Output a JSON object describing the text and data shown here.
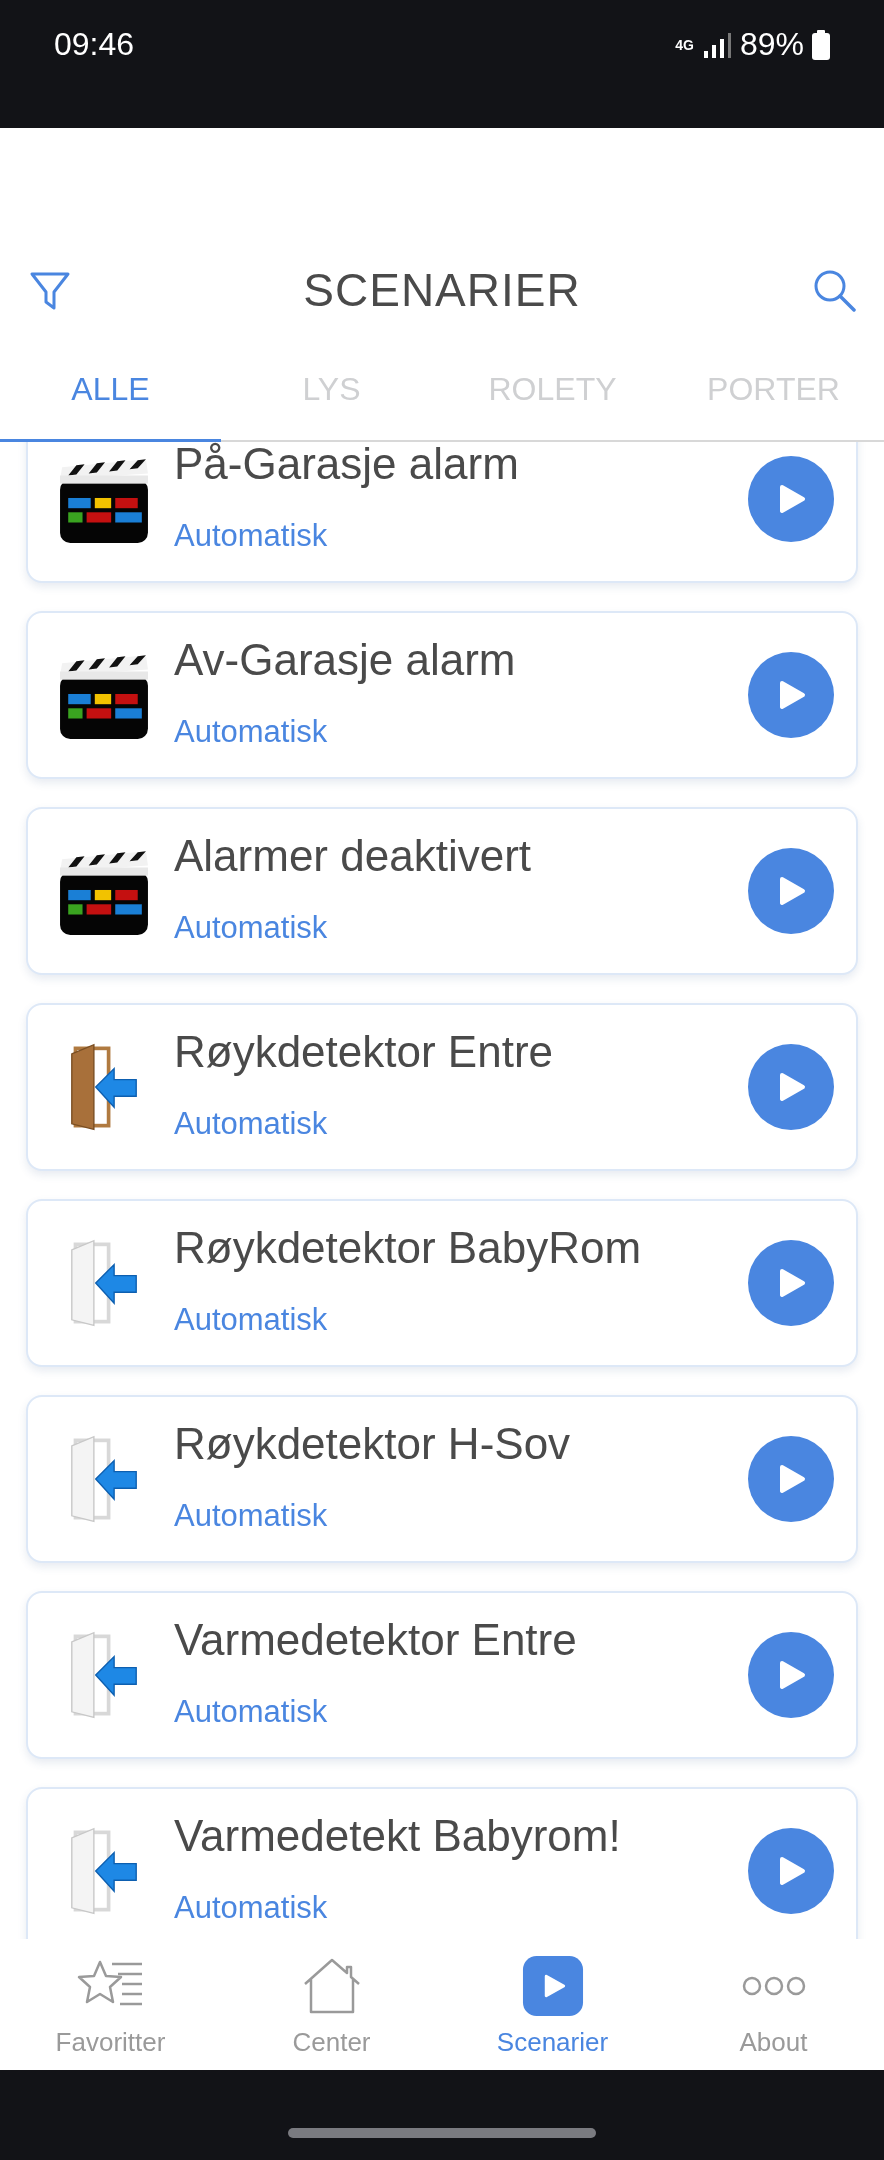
{
  "status_bar": {
    "time": "09:46",
    "network": "4G",
    "battery": "89%"
  },
  "header": {
    "title": "SCENARIER"
  },
  "tabs": [
    {
      "label": "ALLE",
      "selected": true
    },
    {
      "label": "LYS",
      "selected": false
    },
    {
      "label": "ROLETY",
      "selected": false
    },
    {
      "label": "PORTER",
      "selected": false
    }
  ],
  "scenes": [
    {
      "name": "På-Garasje alarm",
      "mode": "Automatisk",
      "kind": "clapper"
    },
    {
      "name": "Av-Garasje alarm",
      "mode": "Automatisk",
      "kind": "clapper"
    },
    {
      "name": "Alarmer deaktivert",
      "mode": "Automatisk",
      "kind": "clapper"
    },
    {
      "name": "Røykdetektor Entre",
      "mode": "Automatisk",
      "kind": "wood-door"
    },
    {
      "name": "Røykdetektor BabyRom",
      "mode": "Automatisk",
      "kind": "white-door"
    },
    {
      "name": "Røykdetektor H-Sov",
      "mode": "Automatisk",
      "kind": "white-door"
    },
    {
      "name": "Varmedetektor Entre",
      "mode": "Automatisk",
      "kind": "white-door"
    },
    {
      "name": "Varmedetekt Babyrom!",
      "mode": "Automatisk",
      "kind": "white-door"
    }
  ],
  "nav": [
    {
      "label": "Favoritter",
      "kind": "favorites",
      "selected": false
    },
    {
      "label": "Center",
      "kind": "home",
      "selected": false
    },
    {
      "label": "Scenarier",
      "kind": "scenes",
      "selected": true
    },
    {
      "label": "About",
      "kind": "more",
      "selected": false
    }
  ]
}
